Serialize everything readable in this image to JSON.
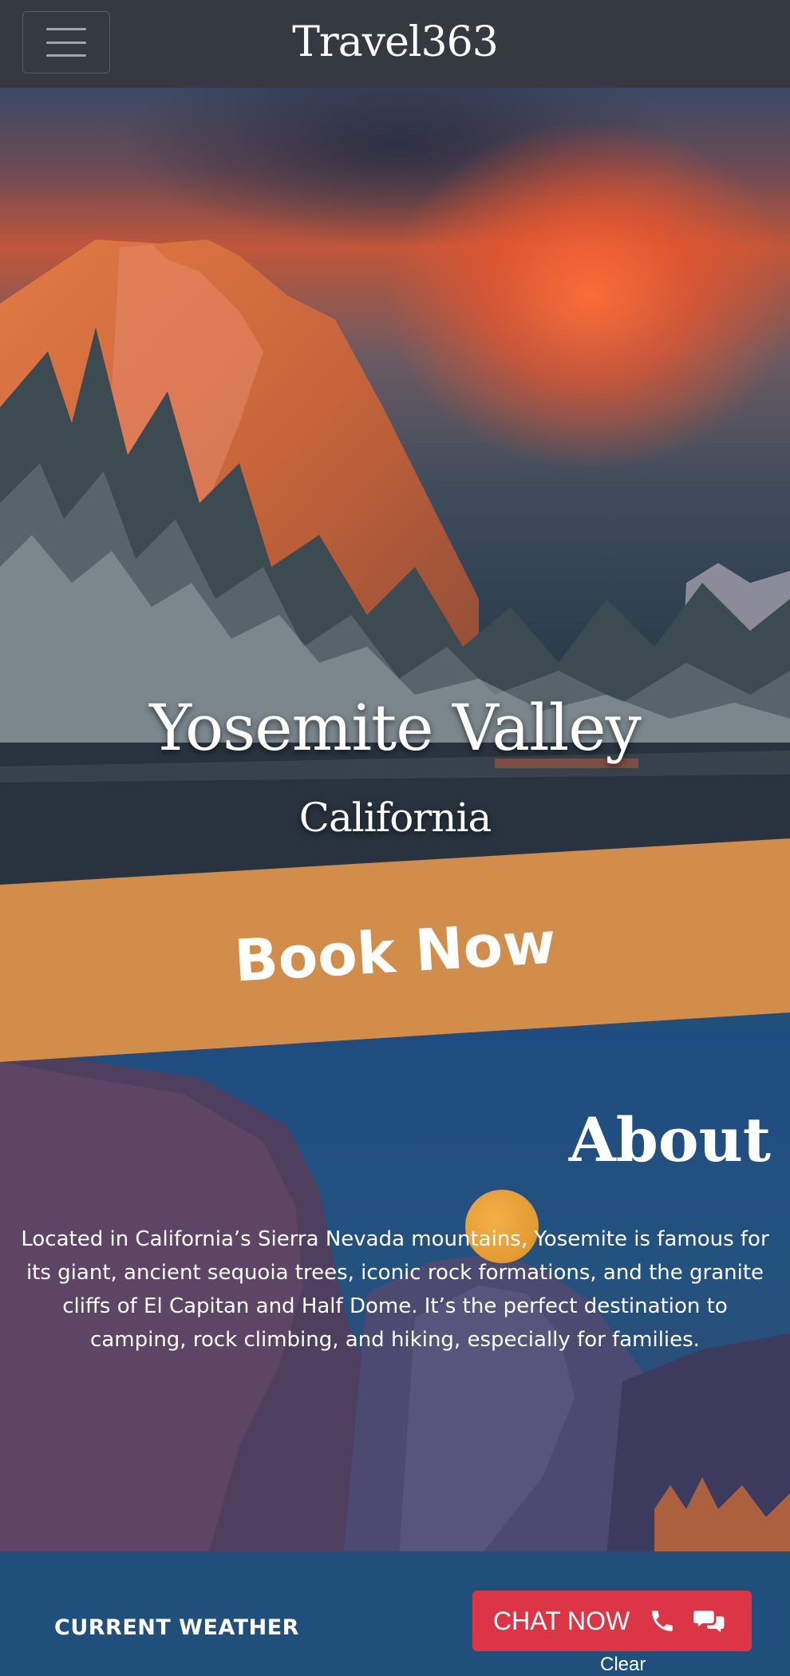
{
  "navbar": {
    "brand": "Travel363",
    "menu_icon": "hamburger-menu-icon"
  },
  "hero": {
    "title": "Yosemite Valley",
    "subtitle": "California"
  },
  "cta": {
    "book_label": "Book Now",
    "color": "#d38d4b"
  },
  "about": {
    "title": "About",
    "text": "Located in California’s Sierra Nevada mountains, Yosemite is famous for its giant, ancient sequoia trees, iconic rock formations, and the granite cliffs of El Capitan and Half Dome. It’s the perfect destination to camping, rock climbing, and hiking, especially for families."
  },
  "weather": {
    "label": "CURRENT WEATHER",
    "icon": "moon-icon",
    "status": "Clear"
  },
  "chat": {
    "label": "CHAT NOW",
    "icons": [
      "phone-icon",
      "chat-bubbles-icon"
    ],
    "color": "#dc3545"
  },
  "colors": {
    "navbar": "#343a40",
    "footer": "#1f4f7a"
  }
}
